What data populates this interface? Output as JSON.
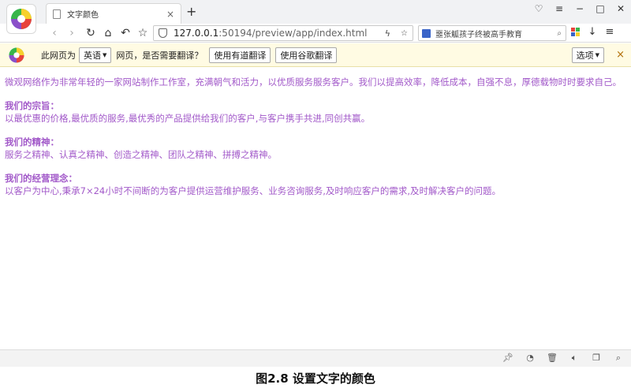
{
  "browser": {
    "tab_title": "文字颜色",
    "tab_close": "×",
    "new_tab": "+",
    "url_host": "127.0.0.1",
    "url_rest": ":50194/preview/app/index.html",
    "search_text": "噩张觚孩子终被高手教育"
  },
  "translate_bar": {
    "prefix": "此网页为",
    "language": "英语",
    "suffix": "网页，是否需要翻译？",
    "youdao_button": "使用有道翻译",
    "google_button": "使用谷歌翻译",
    "options_button": "选项",
    "close": "×"
  },
  "page": {
    "intro": "微观网络作为非常年轻的一家网站制作工作室，充满朝气和活力，以优质服务服务客户。我们以提高效率，降低成本，自强不息，厚德载物时时要求自己。",
    "sections": [
      {
        "heading": "我们的宗旨：",
        "body": "以最优惠的价格,最优质的服务,最优秀的产品提供给我们的客户,与客户携手共进,同创共赢。"
      },
      {
        "heading": "我们的精神：",
        "body": "服务之精神、认真之精神、创造之精神、团队之精神、拼搏之精神。"
      },
      {
        "heading": "我们的经营理念：",
        "body": "以客户为中心,秉承7×24小时不间断的为客户提供运营维护服务、业务咨询服务,及时响应客户的需求,及时解决客户的问题。"
      }
    ]
  },
  "caption": "图2.8  设置文字的颜色",
  "colors": {
    "text_color": "#a259c9",
    "translate_bar_bg": "#fffbe3"
  },
  "icons": {
    "nav": [
      "back-icon",
      "forward-icon",
      "reload-icon",
      "home-icon",
      "undo-icon",
      "star-icon"
    ],
    "status": [
      "pin-icon",
      "speed-icon",
      "trash-icon",
      "speaker-icon",
      "window-icon",
      "zoom-icon"
    ]
  }
}
